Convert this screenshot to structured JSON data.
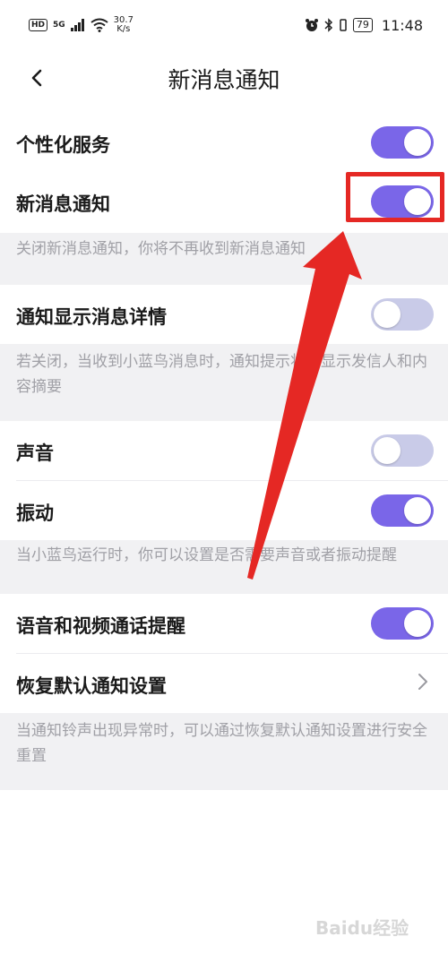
{
  "status_bar": {
    "hd": "HD",
    "network": "5G",
    "speed_value": "30.7",
    "speed_unit": "K/s",
    "battery": "79",
    "time": "11:48"
  },
  "header": {
    "title": "新消息通知"
  },
  "settings": {
    "personalized": {
      "label": "个性化服务",
      "enabled": true
    },
    "new_message": {
      "label": "新消息通知",
      "enabled": true
    },
    "new_message_desc": "关闭新消息通知，你将不再收到新消息通知",
    "show_detail": {
      "label": "通知显示消息详情",
      "enabled": false
    },
    "show_detail_desc": "若关闭，当收到小蓝鸟消息时，通知提示将不显示发信人和内容摘要",
    "sound": {
      "label": "声音",
      "enabled": false
    },
    "vibrate": {
      "label": "振动",
      "enabled": true
    },
    "sound_vibrate_desc": "当小蓝鸟运行时，你可以设置是否需要声音或者振动提醒",
    "call_reminder": {
      "label": "语音和视频通话提醒",
      "enabled": true
    },
    "restore_default": {
      "label": "恢复默认通知设置"
    },
    "restore_desc": "当通知铃声出现异常时，可以通过恢复默认通知设置进行安全重置"
  },
  "watermark": "Baidu经验",
  "colors": {
    "toggle_on": "#7a66e8",
    "toggle_off": "#c9cbe8",
    "annotation": "#e52824"
  }
}
